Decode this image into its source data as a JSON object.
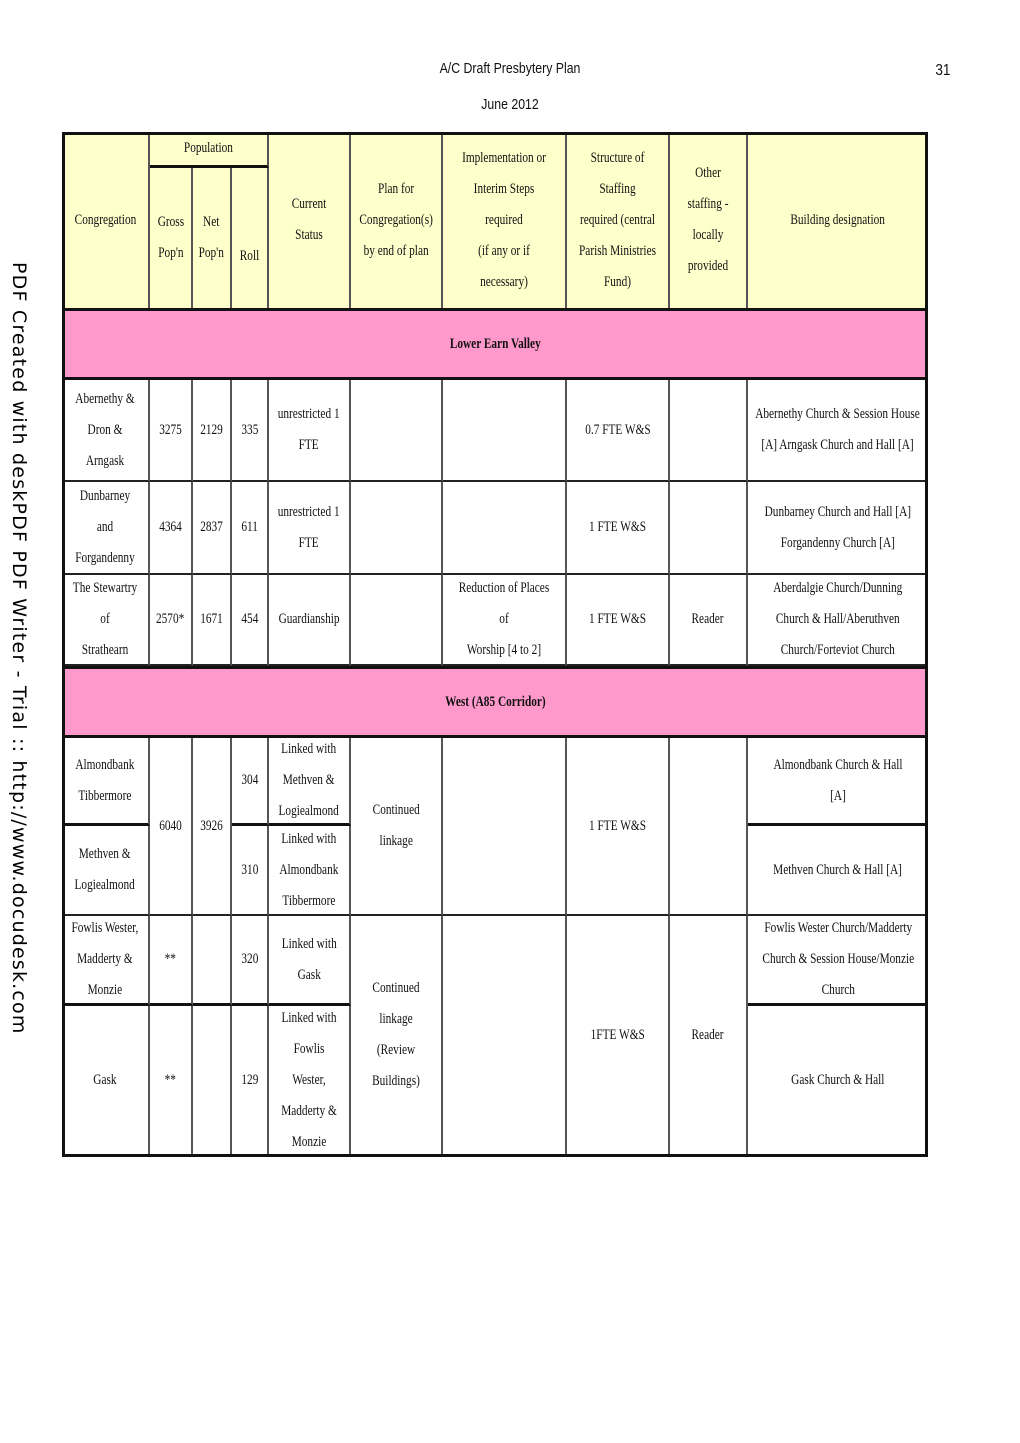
{
  "page": {
    "title": "A/C Draft Presbytery Plan",
    "date": "June 2012",
    "page_number": "31",
    "watermark": "PDF Created with deskPDF PDF Writer - Trial :: http://www.docudesk.com"
  },
  "colors": {
    "header_bg": "#ffffcc",
    "section_bg": "#ff99cc",
    "cell_bg": "#ffffff"
  },
  "table": {
    "headers": {
      "congregation": "Congregation",
      "population": "Population",
      "gross": "Gross\nPop'n",
      "net": "Net\nPop'n",
      "roll": "Roll",
      "current_status": "Current Status",
      "plan": "Plan for\nCongregation(s)\nby end of plan",
      "implementation": "Implementation or\nInterim Steps required\n(if any or if necessary)",
      "structure": "Structure of Staffing\nrequired (central\nParish Ministries\nFund)",
      "other_staffing": "Other staffing -\nlocally\nprovided",
      "building": "Building designation"
    },
    "sections": [
      {
        "title": "Lower Earn Valley",
        "rows": [
          {
            "congregation": "Abernethy &\nDron & Arngask",
            "gross": "3275",
            "net": "2129",
            "roll": "335",
            "current_status": "unrestricted 1\nFTE",
            "plan": "",
            "implementation": "",
            "structure": "0.7 FTE W&S",
            "other_staffing": "",
            "building": "Abernethy Church & Session House\n[A] Arngask Church and Hall [A]"
          },
          {
            "congregation": "Dunbarney and\nForgandenny",
            "gross": "4364",
            "net": "2837",
            "roll": "611",
            "current_status": "unrestricted 1\nFTE",
            "plan": "",
            "implementation": "",
            "structure": "1 FTE W&S",
            "other_staffing": "",
            "building": "Dunbarney Church and Hall [A]\nForgandenny Church [A]"
          },
          {
            "congregation": "The Stewartry of\nStrathearn",
            "gross": "2570*",
            "net": "1671",
            "roll": "454",
            "current_status": "Guardianship",
            "plan": "",
            "implementation": "Reduction of Places of\nWorship [4 to 2]",
            "structure": "1 FTE W&S",
            "other_staffing": "Reader",
            "building": "Aberdalgie Church/Dunning\nChurch & Hall/Aberuthven\nChurch/Forteviot Church"
          }
        ]
      },
      {
        "title": "West (A85 Corridor)",
        "groups": [
          {
            "gross": "6040",
            "net": "3926",
            "plan": "Continued\nlinkage",
            "implementation": "",
            "structure": "1 FTE W&S",
            "other_staffing": "",
            "rows": [
              {
                "congregation": "Almondbank\nTibbermore",
                "roll": "304",
                "current_status": "Linked with\nMethven &\nLogiealmond",
                "building": "Almondbank Church & Hall [A]"
              },
              {
                "congregation": "Methven &\nLogiealmond",
                "roll": "310",
                "current_status": "Linked with\nAlmondbank\nTibbermore",
                "building": "Methven Church & Hall [A]"
              }
            ]
          },
          {
            "gross": "",
            "net": "",
            "plan": "Continued\nlinkage (Review\nBuildings)",
            "implementation": "",
            "structure": "1FTE W&S",
            "other_staffing": "Reader",
            "rows": [
              {
                "congregation": "Fowlis Wester,\nMadderty &\nMonzie",
                "gross": "**",
                "net": "",
                "roll": "320",
                "current_status": "Linked with\nGask",
                "building": "Fowlis Wester Church/Madderty\nChurch & Session House/Monzie\nChurch"
              },
              {
                "congregation": "Gask",
                "gross": "**",
                "net": "",
                "roll": "129",
                "current_status": "Linked with\nFowlis Wester,\nMadderty &\nMonzie",
                "building": "Gask Church & Hall"
              }
            ]
          }
        ]
      }
    ]
  }
}
